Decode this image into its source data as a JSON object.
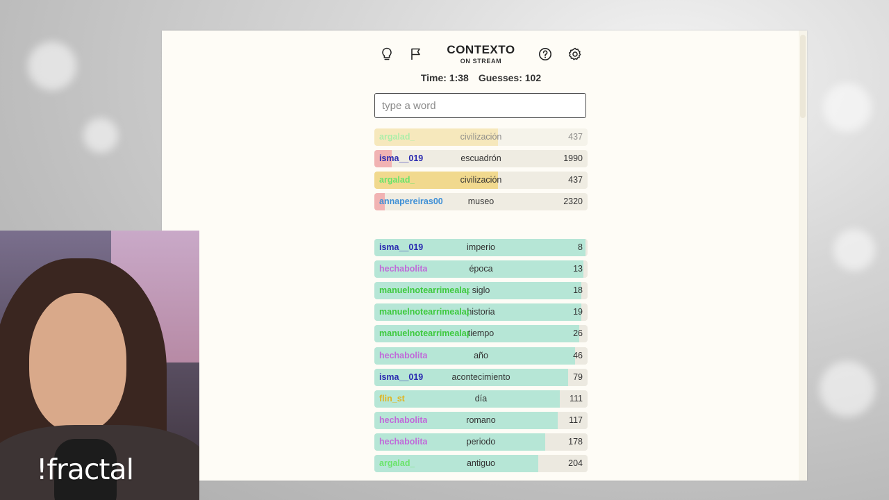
{
  "header": {
    "title": "CONTEXTO",
    "subtitle": "ON STREAM",
    "icons": [
      "lightbulb-icon",
      "flag-icon",
      "help-icon",
      "gear-icon"
    ]
  },
  "stats": {
    "time_label": "Time: 1:38",
    "guesses_label": "Guesses: 102"
  },
  "search": {
    "placeholder": "type a word"
  },
  "colors": {
    "green_fill": "#b6e6d6",
    "yellow_fill": "#f1d98e",
    "red_fill": "#f1b3b3",
    "background": "#fefcf6"
  },
  "recent_guesses": [
    {
      "user": "argalad_",
      "word": "civilización",
      "rank": "437",
      "color": "yellow",
      "user_color": "#6be36b",
      "fill": 0.58
    },
    {
      "user": "isma__019",
      "word": "escuadrón",
      "rank": "1990",
      "color": "red",
      "user_color": "#2a2ab0",
      "fill": 0.08
    },
    {
      "user": "argalad_",
      "word": "civilización",
      "rank": "437",
      "color": "yellow",
      "user_color": "#6be36b",
      "fill": 0.58
    },
    {
      "user": "annapereiras00",
      "word": "museo",
      "rank": "2320",
      "color": "red",
      "user_color": "#3d8fd6",
      "fill": 0.05
    }
  ],
  "guesses": [
    {
      "user": "isma__019",
      "word": "imperio",
      "rank": "8",
      "user_color": "#2a2ab0",
      "fill": 0.99
    },
    {
      "user": "hechabolita",
      "word": "época",
      "rank": "13",
      "user_color": "#c06ad9",
      "fill": 0.98
    },
    {
      "user": "manuelnotearrimealapared",
      "word": "siglo",
      "rank": "18",
      "user_color": "#3ec93e",
      "fill": 0.97
    },
    {
      "user": "manuelnotearrimealapared",
      "word": "historia",
      "rank": "19",
      "user_color": "#3ec93e",
      "fill": 0.97
    },
    {
      "user": "manuelnotearrimealapared",
      "word": "tiempo",
      "rank": "26",
      "user_color": "#3ec93e",
      "fill": 0.96
    },
    {
      "user": "hechabolita",
      "word": "año",
      "rank": "46",
      "user_color": "#c06ad9",
      "fill": 0.94
    },
    {
      "user": "isma__019",
      "word": "acontecimiento",
      "rank": "79",
      "user_color": "#2a2ab0",
      "fill": 0.91
    },
    {
      "user": "flin_st",
      "word": "día",
      "rank": "111",
      "user_color": "#e0b420",
      "fill": 0.87
    },
    {
      "user": "hechabolita",
      "word": "romano",
      "rank": "117",
      "user_color": "#c06ad9",
      "fill": 0.86
    },
    {
      "user": "hechabolita",
      "word": "periodo",
      "rank": "178",
      "user_color": "#c06ad9",
      "fill": 0.8
    },
    {
      "user": "argalad_",
      "word": "antiguo",
      "rank": "204",
      "user_color": "#6be36b",
      "fill": 0.77
    }
  ],
  "webcam": {
    "brand": "!fractal"
  }
}
